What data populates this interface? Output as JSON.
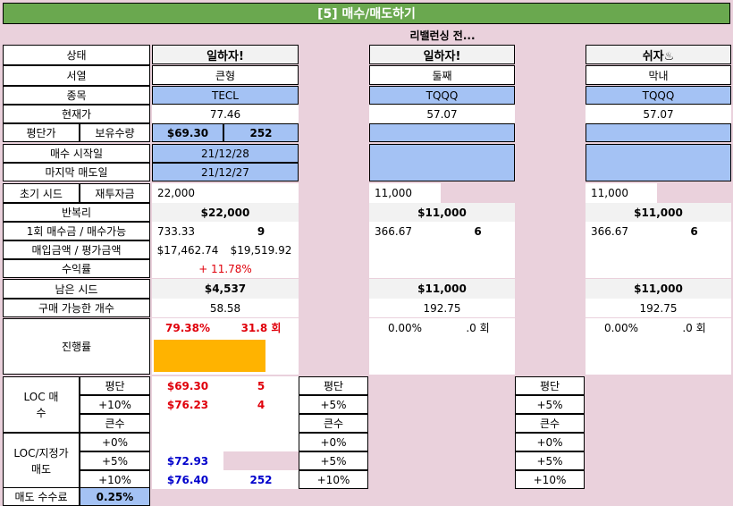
{
  "title": "[5] 매수/매도하기",
  "status_line": "리밸런싱 전...",
  "labels": {
    "status": "상태",
    "order": "서열",
    "ticker": "종목",
    "price": "현재가",
    "avg": "평단가",
    "qty": "보유수량",
    "buy_start": "매수 시작일",
    "last_sell": "마지막 매도일",
    "seed": "초기 시드",
    "reinvest": "재투자금",
    "compound": "반복리",
    "unit": "1회 매수금 / 매수가능",
    "buy_eval": "매입금액 / 평가금액",
    "return": "수익률",
    "remaining": "남은 시드",
    "buyable": "구매 가능한 개수",
    "progress": "진행률",
    "loc_buy": "LOC 매수",
    "avg_short": "평단",
    "plus10": "+10%",
    "big": "큰수",
    "loc_sell": "LOC/지정가 매도",
    "plus0": "+0%",
    "plus5": "+5%",
    "fee": "매도 수수료"
  },
  "fee_value": "0.25%",
  "accent_color": "#6aa84f",
  "highlight_color": "#a4c2f4",
  "progress_color": "#ffb300",
  "cols": [
    {
      "status": "일하자!",
      "order": "큰형",
      "ticker": "TECL",
      "price": "77.46",
      "avg": "$69.30",
      "qty": "252",
      "buy_start": "21/12/28",
      "last_sell": "21/12/27",
      "seed": "22,000",
      "compound": "$22,000",
      "unit": "733.33",
      "can_buy": "9",
      "buy_amt": "$17,462.74",
      "eval_amt": "$19,519.92",
      "return": "+ 11.78%",
      "remaining": "$4,537",
      "buyable": "58.58",
      "progress_pct": "79.38%",
      "progress_count": "31.8 회",
      "progress_fraction": 0.7938,
      "loc_buy_avg_price": "$69.30",
      "loc_buy_avg_qty": "5",
      "loc_buy_10_price": "$76.23",
      "loc_buy_10_qty": "4",
      "side_avg": "평단",
      "side_plus": "+5%",
      "side_big": "큰수",
      "sell_5_price": "$72.93",
      "sell_10_price": "$76.40",
      "sell_10_qty": "252",
      "side_sell0": "+0%",
      "side_sell5": "+5%",
      "side_sell10": "+10%"
    },
    {
      "status": "일하자!",
      "order": "둘째",
      "ticker": "TQQQ",
      "price": "57.07",
      "seed": "11,000",
      "compound": "$11,000",
      "unit": "366.67",
      "can_buy": "6",
      "remaining": "$11,000",
      "buyable": "192.75",
      "progress_pct": "0.00%",
      "progress_count": ".0 회",
      "side_avg": "평단",
      "side_plus": "+5%",
      "side_big": "큰수",
      "side_sell0": "+0%",
      "side_sell5": "+5%",
      "side_sell10": "+10%"
    },
    {
      "status": "쉬자♨",
      "order": "막내",
      "ticker": "TQQQ",
      "price": "57.07",
      "seed": "11,000",
      "compound": "$11,000",
      "unit": "366.67",
      "can_buy": "6",
      "remaining": "$11,000",
      "buyable": "192.75",
      "progress_pct": "0.00%",
      "progress_count": ".0 회"
    }
  ]
}
